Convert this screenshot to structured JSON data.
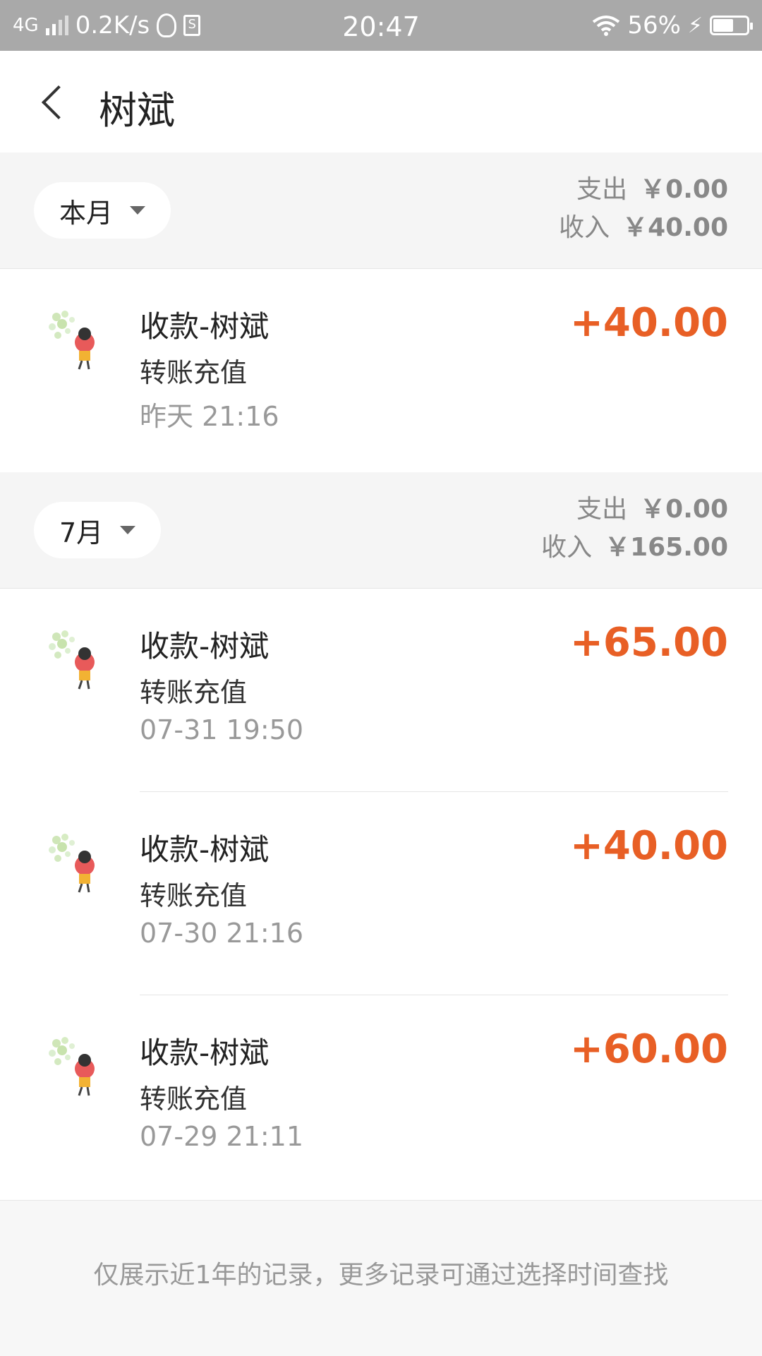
{
  "status_bar": {
    "network": "4G",
    "speed": "0.2K/s",
    "time": "20:47",
    "battery": "56%",
    "battery_level": 0.56
  },
  "header": {
    "title": "树斌",
    "back_icon": "chevron-left-icon"
  },
  "sections": [
    {
      "period": "本月",
      "expense_label": "支出",
      "expense": "￥0.00",
      "income_label": "收入",
      "income": "￥40.00",
      "rows": [
        {
          "title": "收款-树斌",
          "subtitle": "转账充值",
          "time": "昨天  21:16",
          "amount": "+40.00"
        }
      ]
    },
    {
      "period": "7月",
      "expense_label": "支出",
      "expense": "￥0.00",
      "income_label": "收入",
      "income": "￥165.00",
      "rows": [
        {
          "title": "收款-树斌",
          "subtitle": "转账充值",
          "time": "07-31  19:50",
          "amount": "+65.00"
        },
        {
          "title": "收款-树斌",
          "subtitle": "转账充值",
          "time": "07-30  21:16",
          "amount": "+40.00"
        },
        {
          "title": "收款-树斌",
          "subtitle": "转账充值",
          "time": "07-29  21:11",
          "amount": "+60.00"
        }
      ]
    }
  ],
  "footer": {
    "note": "仅展示近1年的记录，更多记录可通过选择时间查找"
  },
  "colors": {
    "amount": "#e85f25",
    "section_bg": "#f5f5f5",
    "status_bar": "#a9a9a9"
  }
}
